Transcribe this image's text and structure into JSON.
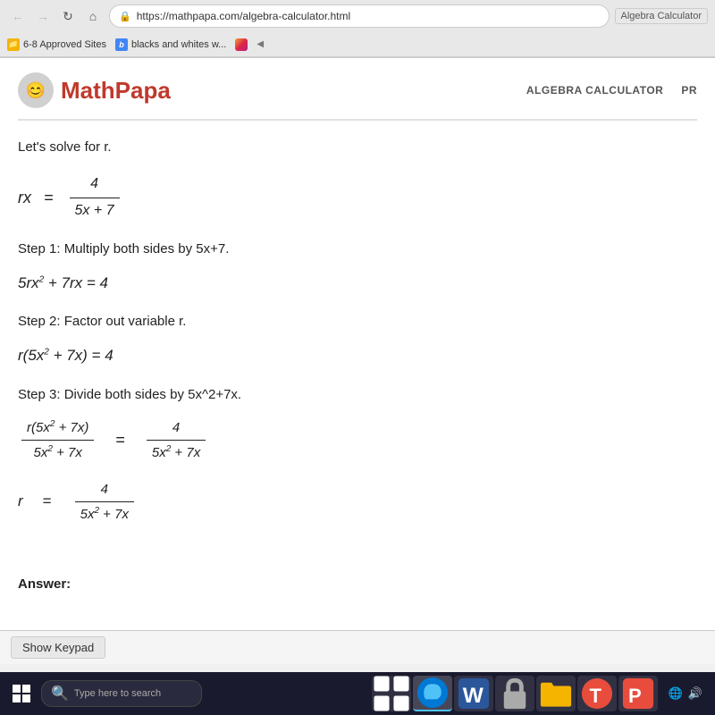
{
  "browser": {
    "back_btn": "←",
    "forward_btn": "→",
    "refresh_btn": "↻",
    "home_btn": "⌂",
    "url": "https://mathpapa.com/algebra-calculator.html",
    "extension_label": "Algebra Calculator",
    "bookmarks": [
      {
        "label": "6-8 Approved Sites",
        "type": "folder"
      },
      {
        "label": "blacks and whites w...",
        "type": "browser"
      },
      {
        "label": "",
        "type": "instagram"
      }
    ],
    "collapse_label": "◀"
  },
  "site": {
    "logo_text": "MathPapa",
    "logo_emoji": "😊",
    "nav_links": [
      "ALGEBRA CALCULATOR",
      "PR"
    ]
  },
  "content": {
    "intro": "Let's solve for r.",
    "original_equation_left": "rx",
    "original_equation_eq": "=",
    "original_numerator": "4",
    "original_denominator": "5x + 7",
    "step1_label": "Step 1: Multiply both sides by 5x+7.",
    "step1_eq": "5rx² + 7rx = 4",
    "step2_label": "Step 2: Factor out variable r.",
    "step2_eq": "r(5x² + 7x) = 4",
    "step3_label": "Step 3: Divide both sides by 5x^2+7x.",
    "step3_left_num": "r(5x² + 7x)",
    "step3_left_den": "5x² + 7x",
    "step3_eq": "=",
    "step3_right_num": "4",
    "step3_right_den": "5x² + 7x",
    "final_r": "r",
    "final_eq": "=",
    "final_num": "4",
    "final_den": "5x² + 7x",
    "answer_label": "Answer:"
  },
  "keypad": {
    "show_label": "Show Keypad"
  },
  "taskbar": {
    "search_placeholder": "Type here to search",
    "search_icon": "🔍"
  }
}
